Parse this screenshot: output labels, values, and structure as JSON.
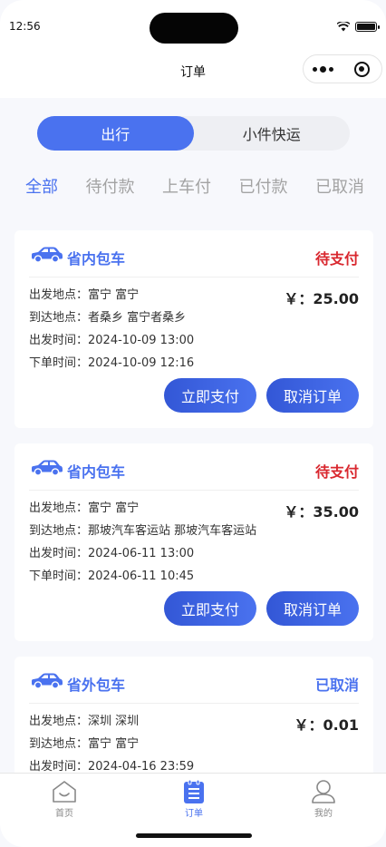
{
  "status_bar": {
    "time": "12:56"
  },
  "nav": {
    "title": "订单"
  },
  "segment": {
    "items": [
      "出行",
      "小件快运"
    ],
    "active_index": 0
  },
  "filter_tabs": {
    "items": [
      "全部",
      "待付款",
      "上车付",
      "已付款",
      "已取消"
    ],
    "active_index": 0
  },
  "orders": [
    {
      "type": "省内包车",
      "status": "待支付",
      "status_color": "#d9282f",
      "price": "￥：25.00",
      "depart_place": "出发地点：富宁 富宁",
      "arrive_place": "到达地点：者桑乡 富宁者桑乡",
      "depart_time": "出发时间：2024-10-09 13:00",
      "order_time": "下单时间：2024-10-09 12:16",
      "pay_label": "立即支付",
      "cancel_label": "取消订单"
    },
    {
      "type": "省内包车",
      "status": "待支付",
      "status_color": "#d9282f",
      "price": "￥：35.00",
      "depart_place": "出发地点：富宁 富宁",
      "arrive_place": "到达地点：那坡汽车客运站 那坡汽车客运站",
      "depart_time": "出发时间：2024-06-11 13:00",
      "order_time": "下单时间：2024-06-11 10:45",
      "pay_label": "立即支付",
      "cancel_label": "取消订单"
    },
    {
      "type": "省外包车",
      "status": "已取消",
      "status_color": "#4a72ef",
      "price": "￥：0.01",
      "depart_place": "出发地点：深圳 深圳",
      "arrive_place": "到达地点：富宁 富宁",
      "depart_time": "出发时间：2024-04-16 23:59"
    }
  ],
  "tabbar": {
    "items": [
      {
        "label": "首页",
        "icon": "home-icon"
      },
      {
        "label": "订单",
        "icon": "order-list-icon"
      },
      {
        "label": "我的",
        "icon": "profile-icon"
      }
    ],
    "active_index": 1
  },
  "colors": {
    "accent": "#4a72ef",
    "danger": "#d9282f",
    "background": "#f7f8fc"
  }
}
